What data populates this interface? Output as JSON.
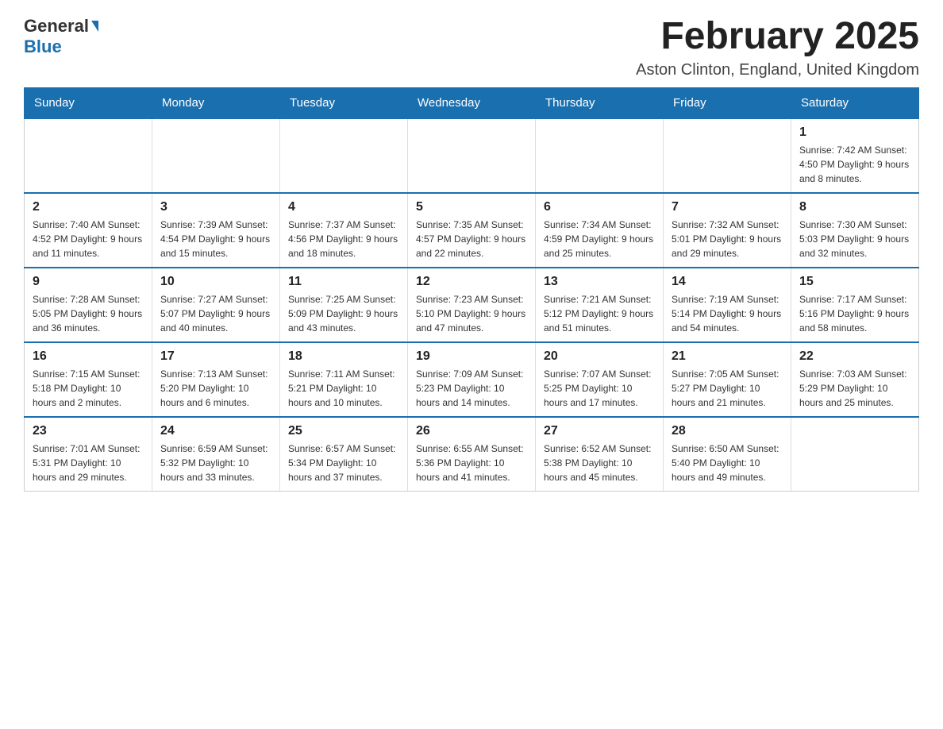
{
  "header": {
    "logo": {
      "general": "General",
      "blue": "Blue"
    },
    "title": "February 2025",
    "location": "Aston Clinton, England, United Kingdom"
  },
  "days_of_week": [
    "Sunday",
    "Monday",
    "Tuesday",
    "Wednesday",
    "Thursday",
    "Friday",
    "Saturday"
  ],
  "weeks": [
    [
      {
        "day": "",
        "info": ""
      },
      {
        "day": "",
        "info": ""
      },
      {
        "day": "",
        "info": ""
      },
      {
        "day": "",
        "info": ""
      },
      {
        "day": "",
        "info": ""
      },
      {
        "day": "",
        "info": ""
      },
      {
        "day": "1",
        "info": "Sunrise: 7:42 AM\nSunset: 4:50 PM\nDaylight: 9 hours and 8 minutes."
      }
    ],
    [
      {
        "day": "2",
        "info": "Sunrise: 7:40 AM\nSunset: 4:52 PM\nDaylight: 9 hours and 11 minutes."
      },
      {
        "day": "3",
        "info": "Sunrise: 7:39 AM\nSunset: 4:54 PM\nDaylight: 9 hours and 15 minutes."
      },
      {
        "day": "4",
        "info": "Sunrise: 7:37 AM\nSunset: 4:56 PM\nDaylight: 9 hours and 18 minutes."
      },
      {
        "day": "5",
        "info": "Sunrise: 7:35 AM\nSunset: 4:57 PM\nDaylight: 9 hours and 22 minutes."
      },
      {
        "day": "6",
        "info": "Sunrise: 7:34 AM\nSunset: 4:59 PM\nDaylight: 9 hours and 25 minutes."
      },
      {
        "day": "7",
        "info": "Sunrise: 7:32 AM\nSunset: 5:01 PM\nDaylight: 9 hours and 29 minutes."
      },
      {
        "day": "8",
        "info": "Sunrise: 7:30 AM\nSunset: 5:03 PM\nDaylight: 9 hours and 32 minutes."
      }
    ],
    [
      {
        "day": "9",
        "info": "Sunrise: 7:28 AM\nSunset: 5:05 PM\nDaylight: 9 hours and 36 minutes."
      },
      {
        "day": "10",
        "info": "Sunrise: 7:27 AM\nSunset: 5:07 PM\nDaylight: 9 hours and 40 minutes."
      },
      {
        "day": "11",
        "info": "Sunrise: 7:25 AM\nSunset: 5:09 PM\nDaylight: 9 hours and 43 minutes."
      },
      {
        "day": "12",
        "info": "Sunrise: 7:23 AM\nSunset: 5:10 PM\nDaylight: 9 hours and 47 minutes."
      },
      {
        "day": "13",
        "info": "Sunrise: 7:21 AM\nSunset: 5:12 PM\nDaylight: 9 hours and 51 minutes."
      },
      {
        "day": "14",
        "info": "Sunrise: 7:19 AM\nSunset: 5:14 PM\nDaylight: 9 hours and 54 minutes."
      },
      {
        "day": "15",
        "info": "Sunrise: 7:17 AM\nSunset: 5:16 PM\nDaylight: 9 hours and 58 minutes."
      }
    ],
    [
      {
        "day": "16",
        "info": "Sunrise: 7:15 AM\nSunset: 5:18 PM\nDaylight: 10 hours and 2 minutes."
      },
      {
        "day": "17",
        "info": "Sunrise: 7:13 AM\nSunset: 5:20 PM\nDaylight: 10 hours and 6 minutes."
      },
      {
        "day": "18",
        "info": "Sunrise: 7:11 AM\nSunset: 5:21 PM\nDaylight: 10 hours and 10 minutes."
      },
      {
        "day": "19",
        "info": "Sunrise: 7:09 AM\nSunset: 5:23 PM\nDaylight: 10 hours and 14 minutes."
      },
      {
        "day": "20",
        "info": "Sunrise: 7:07 AM\nSunset: 5:25 PM\nDaylight: 10 hours and 17 minutes."
      },
      {
        "day": "21",
        "info": "Sunrise: 7:05 AM\nSunset: 5:27 PM\nDaylight: 10 hours and 21 minutes."
      },
      {
        "day": "22",
        "info": "Sunrise: 7:03 AM\nSunset: 5:29 PM\nDaylight: 10 hours and 25 minutes."
      }
    ],
    [
      {
        "day": "23",
        "info": "Sunrise: 7:01 AM\nSunset: 5:31 PM\nDaylight: 10 hours and 29 minutes."
      },
      {
        "day": "24",
        "info": "Sunrise: 6:59 AM\nSunset: 5:32 PM\nDaylight: 10 hours and 33 minutes."
      },
      {
        "day": "25",
        "info": "Sunrise: 6:57 AM\nSunset: 5:34 PM\nDaylight: 10 hours and 37 minutes."
      },
      {
        "day": "26",
        "info": "Sunrise: 6:55 AM\nSunset: 5:36 PM\nDaylight: 10 hours and 41 minutes."
      },
      {
        "day": "27",
        "info": "Sunrise: 6:52 AM\nSunset: 5:38 PM\nDaylight: 10 hours and 45 minutes."
      },
      {
        "day": "28",
        "info": "Sunrise: 6:50 AM\nSunset: 5:40 PM\nDaylight: 10 hours and 49 minutes."
      },
      {
        "day": "",
        "info": ""
      }
    ]
  ]
}
